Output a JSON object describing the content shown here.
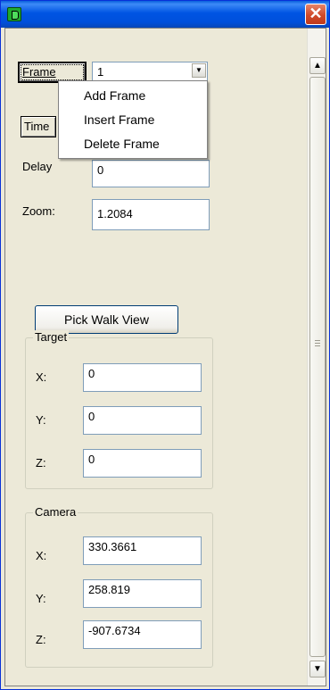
{
  "window": {
    "close_glyph": "✕"
  },
  "fields": {
    "frame_label": "Frame",
    "frame_value": "1",
    "time_label": "Time",
    "delay_label": "Delay",
    "delay_value": "0",
    "zoom_label": "Zoom:",
    "zoom_value": "1.2084"
  },
  "context_menu": {
    "items": [
      "Add Frame",
      "Insert Frame",
      "Delete Frame"
    ]
  },
  "buttons": {
    "pick_walk_view": "Pick Walk View"
  },
  "target": {
    "title": "Target",
    "x_label": "X:",
    "x_value": "0",
    "y_label": "Y:",
    "y_value": "0",
    "z_label": "Z:",
    "z_value": "0"
  },
  "camera": {
    "title": "Camera",
    "x_label": "X:",
    "x_value": "330.3661",
    "y_label": "Y:",
    "y_value": "258.819",
    "z_label": "Z:",
    "z_value": "-907.6734"
  },
  "scrollbar": {
    "up_glyph": "▲",
    "down_glyph": "▼"
  },
  "colors": {
    "titlebar": "#0054e3",
    "close": "#d04a2a",
    "face": "#ece9d8",
    "field_border": "#7f9db9"
  }
}
